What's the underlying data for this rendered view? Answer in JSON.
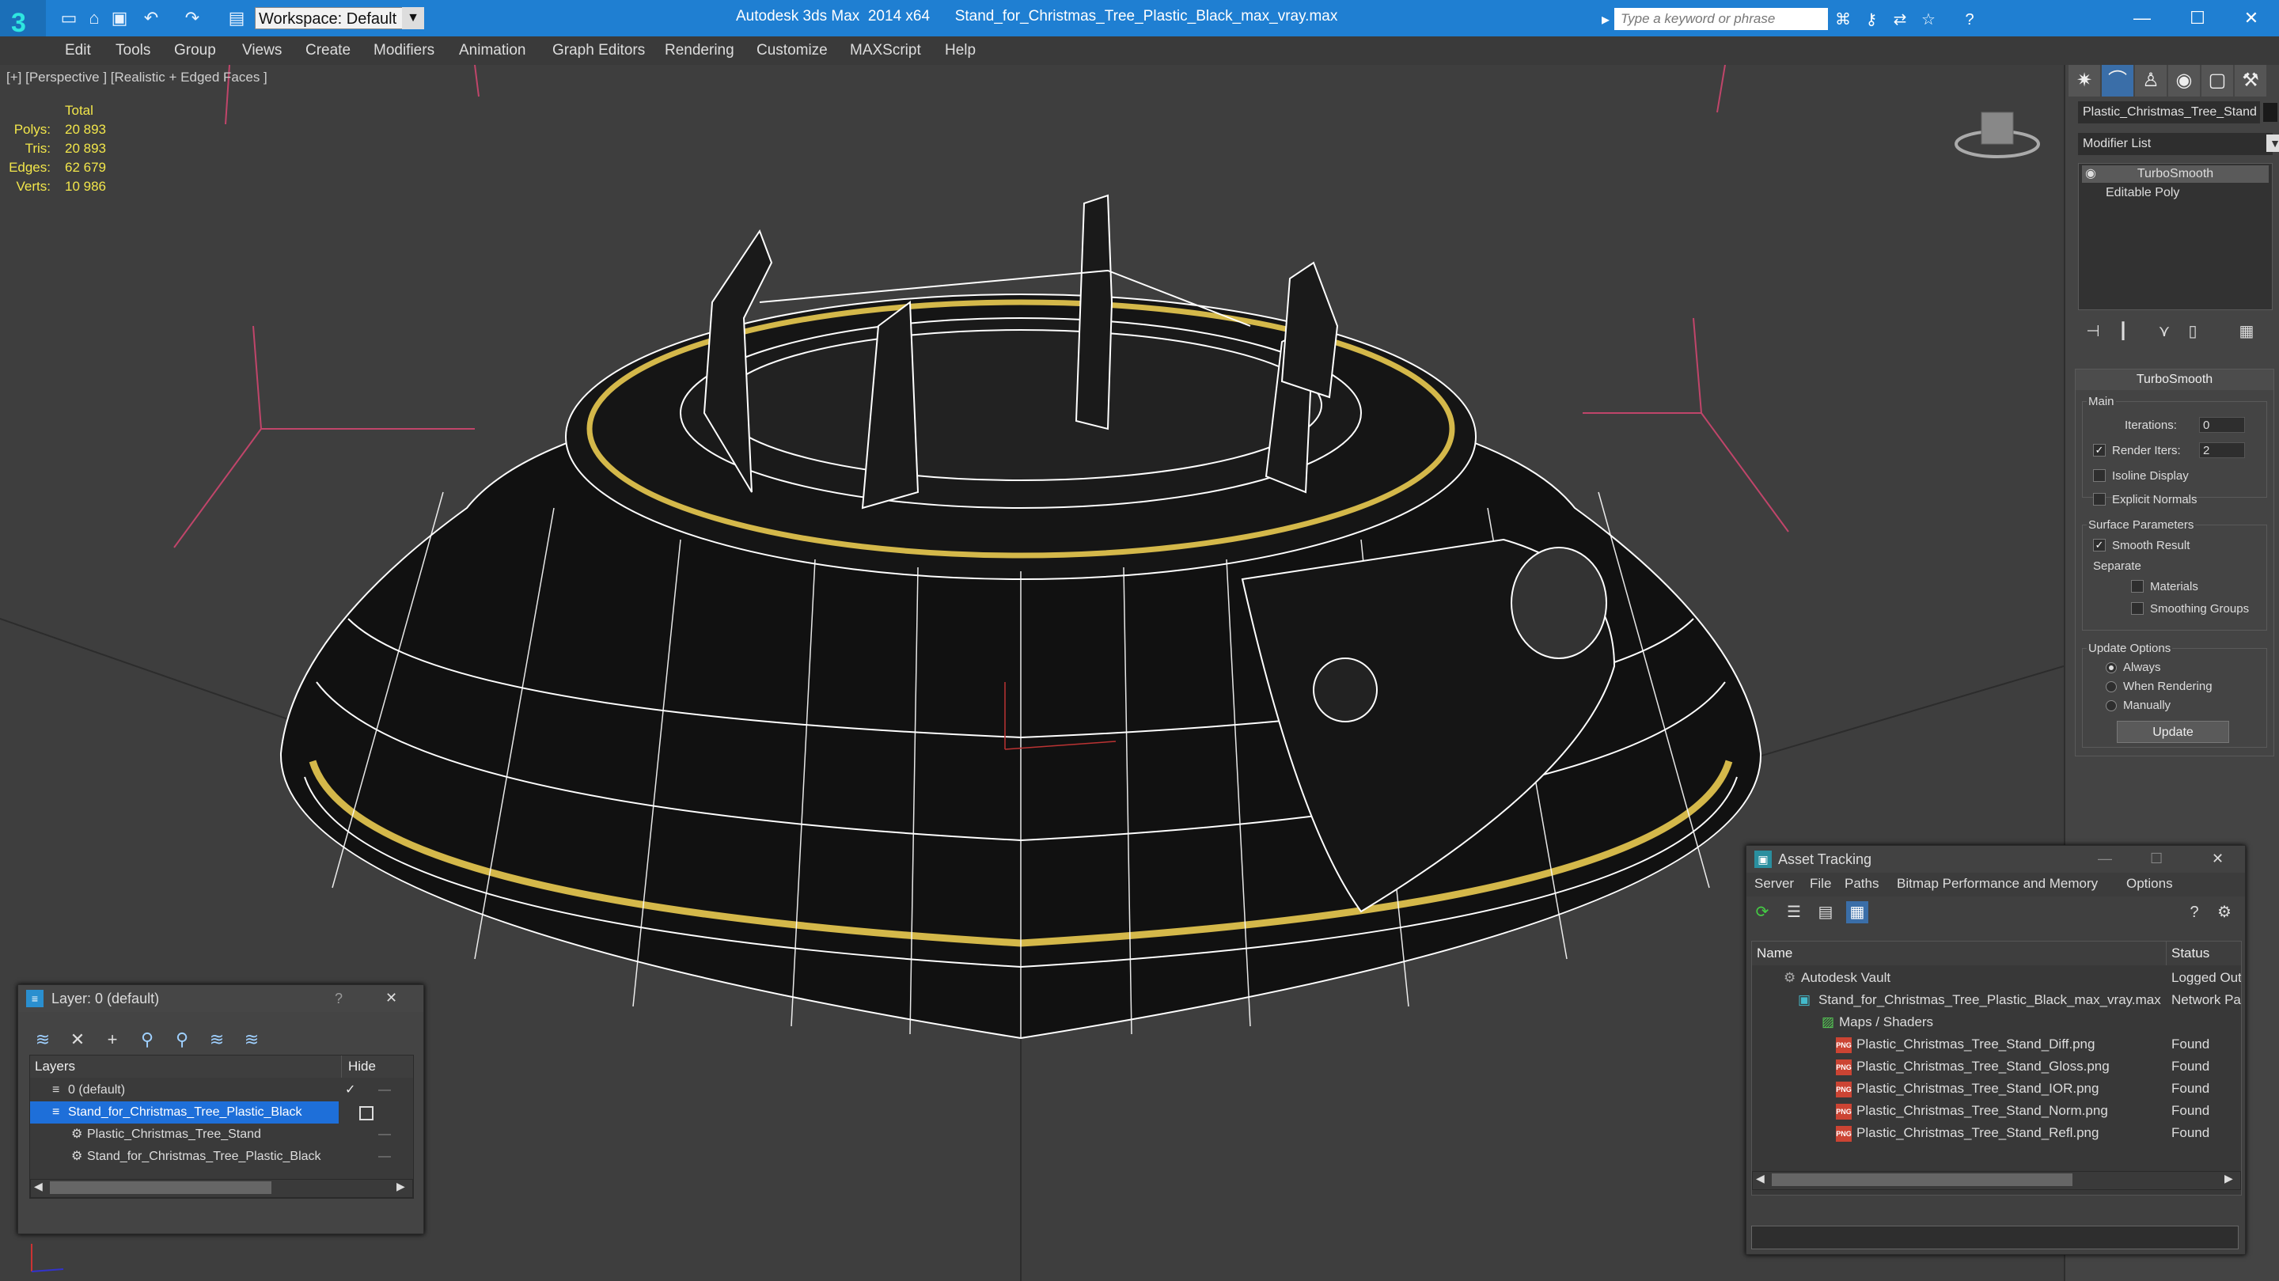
{
  "titlebar": {
    "app_title": "Autodesk 3ds Max  2014 x64      Stand_for_Christmas_Tree_Plastic_Black_max_vray.max",
    "workspace": "Workspace: Default",
    "search_placeholder": "Type a keyword or phrase",
    "minimize": "—",
    "maximize": "☐",
    "close": "✕"
  },
  "menus": [
    "Edit",
    "Tools",
    "Group",
    "Views",
    "Create",
    "Modifiers",
    "Animation",
    "Graph Editors",
    "Rendering",
    "Customize",
    "MAXScript",
    "Help"
  ],
  "viewport": {
    "label": "[+] [Perspective ] [Realistic + Edged Faces ]",
    "stats": {
      "header": "Total",
      "rows": [
        {
          "label": "Polys:",
          "value": "20 893"
        },
        {
          "label": "Tris:",
          "value": "20 893"
        },
        {
          "label": "Edges:",
          "value": "62 679"
        },
        {
          "label": "Verts:",
          "value": "10 986"
        }
      ]
    }
  },
  "command_panel": {
    "object_name": "Plastic_Christmas_Tree_Stand",
    "modifier_list": "Modifier List",
    "stack": [
      "TurboSmooth",
      "Editable Poly"
    ],
    "rollout": {
      "title": "TurboSmooth",
      "main_label": "Main",
      "iterations_label": "Iterations:",
      "iterations_value": "0",
      "render_iters_label": "Render Iters:",
      "render_iters_value": "2",
      "isoline": "Isoline Display",
      "explicit_normals": "Explicit Normals",
      "surface_params": "Surface Parameters",
      "smooth_result": "Smooth Result",
      "separate": "Separate",
      "materials": "Materials",
      "smoothing_groups": "Smoothing Groups",
      "update_options": "Update Options",
      "always": "Always",
      "when_rendering": "When Rendering",
      "manually": "Manually",
      "update_button": "Update"
    }
  },
  "layer_dialog": {
    "title": "Layer: 0 (default)",
    "help": "?",
    "close": "✕",
    "col_layers": "Layers",
    "col_hide": "Hide",
    "rows": [
      {
        "name": "0 (default)"
      },
      {
        "name": "Stand_for_Christmas_Tree_Plastic_Black"
      },
      {
        "name": "Plastic_Christmas_Tree_Stand"
      },
      {
        "name": "Stand_for_Christmas_Tree_Plastic_Black"
      }
    ]
  },
  "asset_tracking": {
    "title": "Asset Tracking",
    "menu": [
      "Server",
      "File",
      "Paths",
      "Bitmap Performance and Memory",
      "Options"
    ],
    "col_name": "Name",
    "col_status": "Status",
    "rows": [
      {
        "name": "Autodesk Vault",
        "status": "Logged Out"
      },
      {
        "name": "Stand_for_Christmas_Tree_Plastic_Black_max_vray.max",
        "status": "Network Path"
      },
      {
        "name": "Maps / Shaders",
        "status": ""
      },
      {
        "name": "Plastic_Christmas_Tree_Stand_Diff.png",
        "status": "Found"
      },
      {
        "name": "Plastic_Christmas_Tree_Stand_Gloss.png",
        "status": "Found"
      },
      {
        "name": "Plastic_Christmas_Tree_Stand_IOR.png",
        "status": "Found"
      },
      {
        "name": "Plastic_Christmas_Tree_Stand_Norm.png",
        "status": "Found"
      },
      {
        "name": "Plastic_Christmas_Tree_Stand_Refl.png",
        "status": "Found"
      }
    ]
  },
  "colors": {
    "titlebar": "#1f7fd2",
    "selection": "#1e6fd9",
    "stats": "#f2e64a",
    "wire_gold": "#d4b84a"
  }
}
